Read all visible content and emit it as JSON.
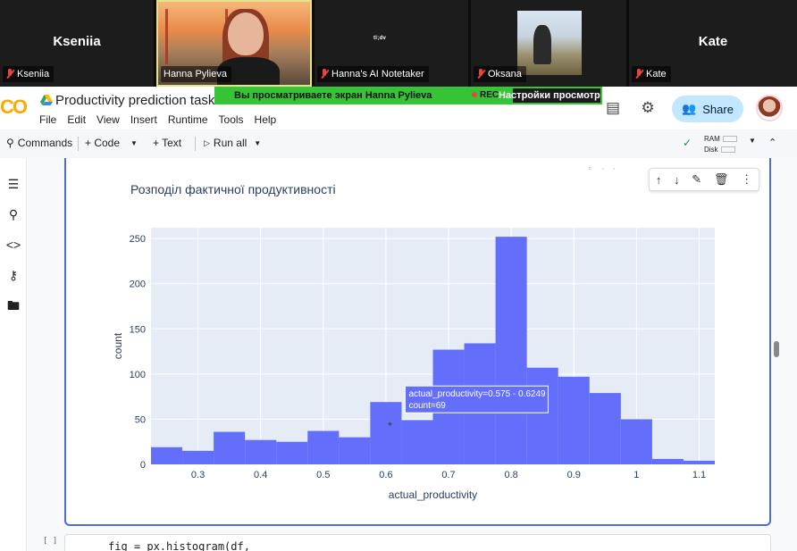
{
  "meeting": {
    "tiles": [
      {
        "name": "Kseniia",
        "big": "Kseniia",
        "tag": "Kseniia"
      },
      {
        "name": "Hanna Pylieva",
        "big": "",
        "tag": "Hanna Pylieva"
      },
      {
        "name": "Hanna's AI Notetaker",
        "big": "",
        "tag": "Hanna's AI Notetaker",
        "logo": "tl;dv"
      },
      {
        "name": "Oksana",
        "big": "",
        "tag": "Oksana"
      },
      {
        "name": "Kate",
        "big": "Kate",
        "tag": "Kate"
      }
    ]
  },
  "share_banner": {
    "message": "Вы просматриваете экран  Hanna Pylieva",
    "rec": "REC",
    "settings": "Настройки просмотр"
  },
  "colab": {
    "logo": "CO",
    "title": "Productivity prediction task",
    "menu": [
      "File",
      "Edit",
      "View",
      "Insert",
      "Runtime",
      "Tools",
      "Help"
    ],
    "share_label": "Share",
    "toolbar": {
      "commands": "Commands",
      "code": "+ Code",
      "text": "+ Text",
      "run_all": "Run all",
      "ram": "RAM",
      "disk": "Disk"
    }
  },
  "code_cell": {
    "bracket": "[ ]",
    "code": "fig = px.histogram(df,"
  },
  "chart_data": {
    "type": "bar",
    "title": "Розподіл фактичної продуктивності",
    "xlabel": "actual_productivity",
    "ylabel": "count",
    "bin_width": 0.05,
    "bin_starts": [
      0.225,
      0.275,
      0.325,
      0.375,
      0.425,
      0.475,
      0.525,
      0.575,
      0.625,
      0.675,
      0.725,
      0.775,
      0.825,
      0.875,
      0.925,
      0.975,
      1.025,
      1.075
    ],
    "values": [
      19,
      15,
      36,
      27,
      25,
      37,
      30,
      69,
      49,
      127,
      134,
      252,
      107,
      97,
      79,
      50,
      6,
      4
    ],
    "xlim": [
      0.225,
      1.125
    ],
    "ylim": [
      0,
      262
    ],
    "x_ticks": [
      0.3,
      0.4,
      0.5,
      0.6,
      0.7,
      0.8,
      0.9,
      1,
      1.1
    ],
    "x_tick_labels": [
      "0.3",
      "0.4",
      "0.5",
      "0.6",
      "0.7",
      "0.8",
      "0.9",
      "1",
      "1.1"
    ],
    "y_ticks": [
      0,
      50,
      100,
      150,
      200,
      250
    ],
    "y_tick_labels": [
      "0",
      "50",
      "100",
      "150",
      "200",
      "250"
    ],
    "grid": true,
    "bar_color": "#636efa",
    "plot_bg": "#e5ecf6",
    "hover": {
      "line1": "actual_productivity=0.575 - 0.6249",
      "line2": "count=69"
    }
  }
}
